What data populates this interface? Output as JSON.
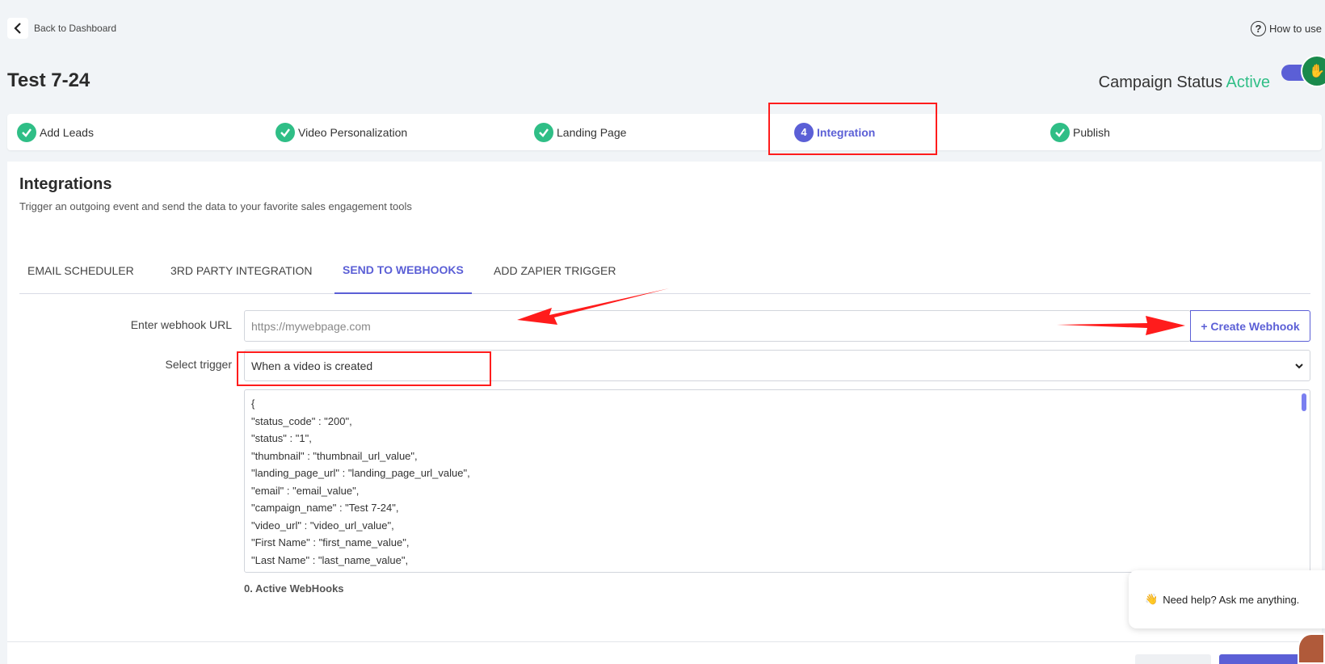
{
  "nav": {
    "back_label": "Back to Dashboard",
    "how_to_use": "How to use"
  },
  "header": {
    "title": "Test 7-24",
    "status_label": "Campaign Status",
    "status_value": "Active"
  },
  "steps": [
    {
      "label": "Add Leads",
      "state": "done"
    },
    {
      "label": "Video Personalization",
      "state": "done"
    },
    {
      "label": "Landing Page",
      "state": "done"
    },
    {
      "label": "Integration",
      "state": "current",
      "number": "4"
    },
    {
      "label": "Publish",
      "state": "done"
    }
  ],
  "integrations": {
    "title": "Integrations",
    "subtitle": "Trigger an outgoing event and send the data to your favorite sales engagement tools",
    "tabs": [
      {
        "label": "EMAIL SCHEDULER"
      },
      {
        "label": "3RD PARTY INTEGRATION"
      },
      {
        "label": "SEND TO WEBHOOKS"
      },
      {
        "label": "ADD ZAPIER TRIGGER"
      }
    ],
    "webhook_url_label": "Enter webhook URL",
    "webhook_url_placeholder": "https://mywebpage.com",
    "create_webhook_label": "+ Create Webhook",
    "trigger_label": "Select trigger",
    "trigger_value": "When a video is created",
    "payload_lines": [
      "{",
      "\"status_code\" : \"200\",",
      "\"status\" : \"1\",",
      "\"thumbnail\" : \"thumbnail_url_value\",",
      "\"landing_page_url\" : \"landing_page_url_value\",",
      "\"email\" : \"email_value\",",
      "\"campaign_name\" : \"Test 7-24\",",
      "\"video_url\" : \"video_url_value\",",
      "\"First Name\" : \"first_name_value\",",
      "\"Last Name\" : \"last_name_value\","
    ],
    "active_webhooks": "0. Active WebHooks"
  },
  "chat": {
    "emoji": "👋",
    "text": "Need help? Ask me anything."
  },
  "colors": {
    "accent": "#5b5fd6",
    "success": "#2fbe86",
    "annotation": "#ff1c1c"
  }
}
